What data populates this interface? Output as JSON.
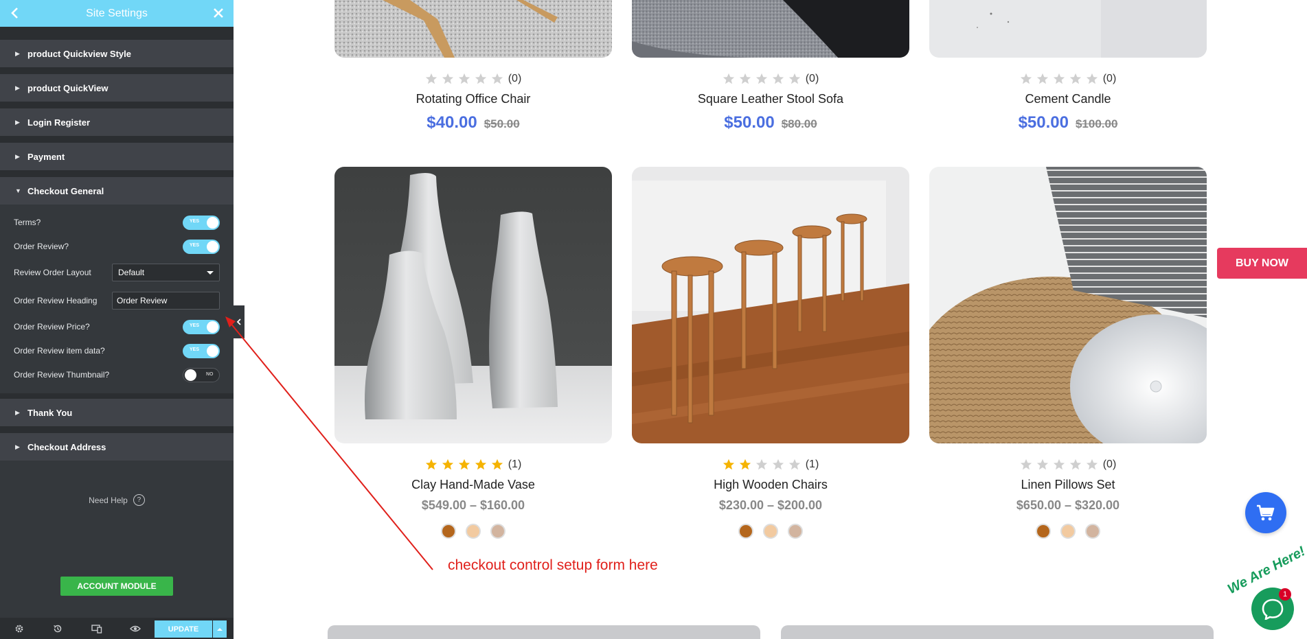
{
  "sidebar": {
    "title": "Site Settings",
    "sections_top": [
      "product Quickview Style",
      "product QuickView",
      "Login Register",
      "Payment",
      "Checkout General"
    ],
    "checkout_general": {
      "terms_label": "Terms?",
      "terms_state": "YES",
      "order_review_label": "Order Review?",
      "order_review_state": "YES",
      "layout_label": "Review Order Layout",
      "layout_value": "Default",
      "heading_label": "Order Review Heading",
      "heading_value": "Order Review",
      "price_label": "Order Review Price?",
      "price_state": "YES",
      "item_label": "Order Review item data?",
      "item_state": "YES",
      "thumb_label": "Order Review Thumbnail?",
      "thumb_state": "NO"
    },
    "sections_bottom": [
      "Thank You",
      "Checkout Address"
    ],
    "help_label": "Need Help",
    "account_button": "ACCOUNT MODULE",
    "update_button": "UPDATE"
  },
  "products_top": [
    {
      "name": "Rotating Office Chair",
      "rating_count": "(0)",
      "price": "$40.00",
      "old_price": "$50.00"
    },
    {
      "name": "Square Leather Stool Sofa",
      "rating_count": "(0)",
      "price": "$50.00",
      "old_price": "$80.00"
    },
    {
      "name": "Cement Candle",
      "rating_count": "(0)",
      "price": "$50.00",
      "old_price": "$100.00"
    }
  ],
  "products_bottom": [
    {
      "name": "Clay Hand-Made Vase",
      "rating_count": "(1)",
      "stars": 5,
      "price_range": "$549.00 – $160.00"
    },
    {
      "name": "High Wooden Chairs",
      "rating_count": "(1)",
      "stars": 2,
      "price_range": "$230.00 – $200.00"
    },
    {
      "name": "Linen Pillows Set",
      "rating_count": "(0)",
      "stars": 0,
      "price_range": "$650.00 – $320.00"
    }
  ],
  "swatch_colors": [
    "#b4661c",
    "#f2caa0",
    "#d2b49f"
  ],
  "buy_now": "BUY NOW",
  "chat": {
    "badge": "1",
    "tag": "We Are Here!"
  },
  "annotation": "checkout control setup form here",
  "colors": {
    "accent": "#71d7f7",
    "price_blue": "#4a6ee0",
    "star": "#f5b301",
    "buy_now": "#e63a5e",
    "annotation_red": "#e0201b"
  }
}
